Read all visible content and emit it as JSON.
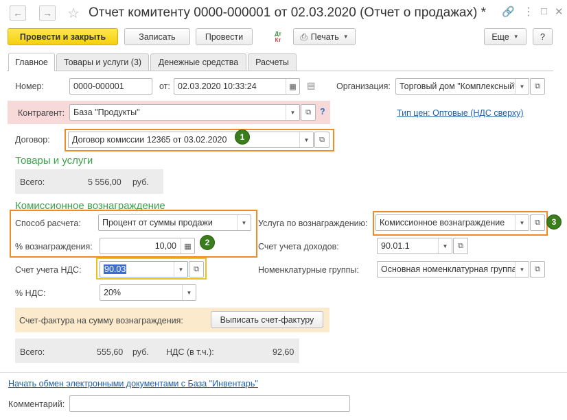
{
  "window": {
    "title": "Отчет комитенту 0000-000001 от 02.03.2020 (Отчет о продажах) *"
  },
  "toolbar": {
    "post_close": "Провести и закрыть",
    "save": "Записать",
    "post": "Провести",
    "dt_kt_top": "Дт",
    "dt_kt_bottom": "Кт",
    "print": "Печать",
    "more": "Еще",
    "help": "?"
  },
  "tabs": [
    {
      "label": "Главное",
      "active": true
    },
    {
      "label": "Товары и услуги (3)",
      "active": false
    },
    {
      "label": "Денежные средства",
      "active": false
    },
    {
      "label": "Расчеты",
      "active": false
    }
  ],
  "header": {
    "number_label": "Номер:",
    "number_value": "0000-000001",
    "date_label": "от:",
    "date_value": "02.03.2020 10:33:24",
    "org_label": "Организация:",
    "org_value": "Торговый дом \"Комплексный\"",
    "counterparty_label": "Контрагент:",
    "counterparty_value": "База \"Продукты\"",
    "question": "?",
    "price_type_link": "Тип цен: Оптовые (НДС сверху)",
    "contract_label": "Договор:",
    "contract_value": "Договор комиссии 12365 от 03.02.2020"
  },
  "goods": {
    "section_title": "Товары и услуги",
    "total_label": "Всего:",
    "total_value": "5 556,00",
    "currency": "руб."
  },
  "commission": {
    "section_title": "Комиссионное вознаграждение",
    "method_label": "Способ расчета:",
    "method_value": "Процент от суммы продажи",
    "percent_label": "% вознаграждения:",
    "percent_value": "10,00",
    "service_label": "Услуга по вознаграждению:",
    "service_value": "Комиссионное вознаграждение",
    "income_account_label": "Счет учета доходов:",
    "income_account_value": "90.01.1",
    "vat_account_label": "Счет учета НДС:",
    "vat_account_value": "90.03",
    "nomenclature_label": "Номенклатурные группы:",
    "nomenclature_value": "Основная номенклатурная группа",
    "vat_label": "% НДС:",
    "vat_value": "20%",
    "invoice_label": "Счет-фактура на сумму вознаграждения:",
    "invoice_button": "Выписать счет-фактуру",
    "total_label": "Всего:",
    "total_value": "555,60",
    "currency": "руб.",
    "vat_incl_label": "НДС (в т.ч.):",
    "vat_incl_value": "92,60"
  },
  "footer": {
    "edo_link": "Начать обмен электронными документами с База \"Инвентарь\"",
    "comment_label": "Комментарий:",
    "comment_value": ""
  },
  "badges": [
    "1",
    "2",
    "3"
  ],
  "colors": {
    "primary_button": "#f6cf0f",
    "highlight_orange": "#ef8a24",
    "badge_green": "#3a7d1c",
    "section_green": "#3aa14a",
    "link_blue": "#1e5fa8",
    "counterparty_bg": "#f7d9d9",
    "invoice_bg": "#fbeacb",
    "selection_bg": "#3b6fd4"
  }
}
